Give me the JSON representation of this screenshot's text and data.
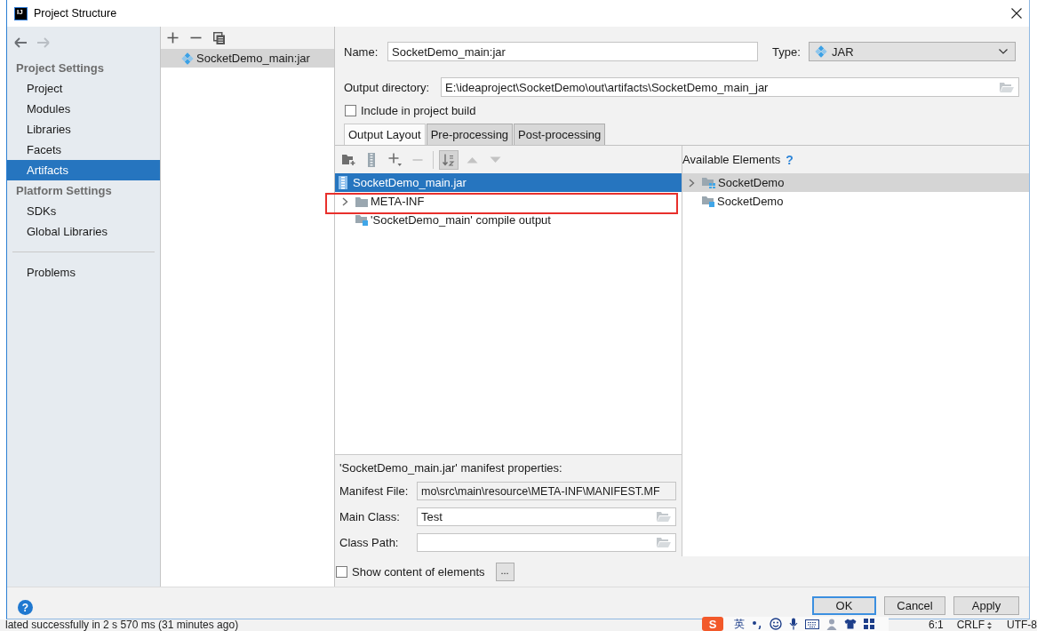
{
  "window": {
    "logo": "IJ",
    "title": "Project Structure"
  },
  "sidebar": {
    "nav": [
      {
        "kind": "back",
        "disabled": false
      },
      {
        "kind": "forward",
        "disabled": true
      }
    ],
    "sections": [
      {
        "heading": "Project Settings",
        "items": [
          {
            "label": "Project",
            "selected": false
          },
          {
            "label": "Modules",
            "selected": false
          },
          {
            "label": "Libraries",
            "selected": false
          },
          {
            "label": "Facets",
            "selected": false
          },
          {
            "label": "Artifacts",
            "selected": true
          }
        ]
      },
      {
        "heading": "Platform Settings",
        "items": [
          {
            "label": "SDKs",
            "selected": false
          },
          {
            "label": "Global Libraries",
            "selected": false
          }
        ]
      }
    ],
    "footer_items": [
      {
        "label": "Problems",
        "selected": false
      }
    ]
  },
  "artifact_list": {
    "toolbar": [
      {
        "kind": "add"
      },
      {
        "kind": "remove"
      },
      {
        "kind": "copy"
      }
    ],
    "items": [
      {
        "label": "SocketDemo_main:jar",
        "selected": true
      }
    ]
  },
  "form": {
    "name": {
      "label": "Name:",
      "value": "SocketDemo_main:jar"
    },
    "type": {
      "label": "Type:",
      "value": "JAR"
    },
    "output_directory": {
      "label": "Output directory:",
      "value": "E:\\ideaproject\\SocketDemo\\out\\artifacts\\SocketDemo_main_jar"
    },
    "include_in_build": {
      "label": "Include in project build",
      "checked": false
    }
  },
  "tabs": [
    {
      "label": "Output Layout",
      "selected": true
    },
    {
      "label": "Pre-processing",
      "selected": false
    },
    {
      "label": "Post-processing",
      "selected": false
    }
  ],
  "output_layout": {
    "toolbar": [
      {
        "kind": "new-directory",
        "disabled": false,
        "pressed": false
      },
      {
        "kind": "archive",
        "disabled": false,
        "pressed": false
      },
      {
        "kind": "add",
        "disabled": false,
        "pressed": false
      },
      {
        "kind": "remove",
        "disabled": true,
        "pressed": false
      },
      {
        "kind": "sort",
        "disabled": false,
        "pressed": true
      },
      {
        "kind": "move-up",
        "disabled": true,
        "pressed": false
      },
      {
        "kind": "move-down",
        "disabled": true,
        "pressed": false
      }
    ],
    "tree": [
      {
        "label": "SocketDemo_main.jar",
        "kind": "archive",
        "selected": true,
        "highlighted": false,
        "children": [
          {
            "label": "META-INF",
            "kind": "directory",
            "selected": false,
            "expanded": false,
            "highlighted": true
          },
          {
            "label": "'SocketDemo_main' compile output",
            "kind": "module-output",
            "selected": false,
            "highlighted": false
          }
        ]
      }
    ],
    "manifest": {
      "title": "'SocketDemo_main.jar' manifest properties:",
      "fields": [
        {
          "label": "Manifest File:",
          "value": "mo\\src\\main\\resource\\META-INF\\MANIFEST.MF",
          "kind": "readonly"
        },
        {
          "label": "Main Class:",
          "value": "Test",
          "kind": "browse"
        },
        {
          "label": "Class Path:",
          "kind": "browse"
        }
      ]
    },
    "show_content": {
      "label": "Show content of elements",
      "checked": false,
      "button": "..."
    }
  },
  "available_elements": {
    "title": "Available Elements",
    "help": "?",
    "tree": [
      {
        "label": "SocketDemo",
        "kind": "module",
        "selected": true,
        "expanded": false
      },
      {
        "label": "SocketDemo",
        "kind": "module-output",
        "selected": false
      }
    ]
  },
  "buttons": [
    {
      "label": "OK",
      "kind": "default"
    },
    {
      "label": "Cancel",
      "kind": "normal"
    },
    {
      "label": "Apply",
      "kind": "normal"
    }
  ],
  "help_button": "?",
  "background": {
    "status_message": "lated successfully in 2 s 570 ms (31 minutes ago)",
    "cursor_position": "6:1",
    "line_separator": "CRLF",
    "encoding": "UTF-8"
  },
  "input_method_bar": {
    "logo": "S",
    "mode": "英"
  }
}
